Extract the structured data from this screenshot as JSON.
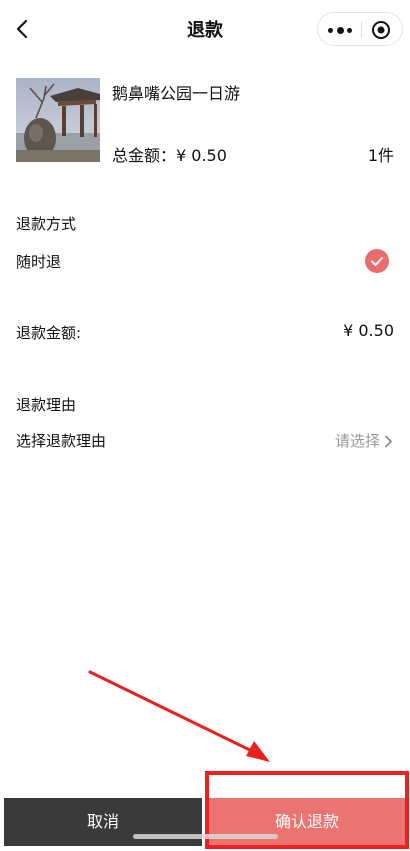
{
  "nav": {
    "title": "退款"
  },
  "product": {
    "name": "鹅鼻嘴公园一日游",
    "total_label": "总金额：",
    "total_value": "¥ 0.50",
    "quantity": "1件"
  },
  "refund_method": {
    "heading": "退款方式",
    "option": "随时退"
  },
  "refund_amount": {
    "label": "退款金额:",
    "value": "¥ 0.50"
  },
  "refund_reason": {
    "heading": "退款理由",
    "label": "选择退款理由",
    "placeholder": "请选择"
  },
  "buttons": {
    "cancel": "取消",
    "confirm": "确认退款"
  },
  "colors": {
    "accent": "#ea7570",
    "cancel_bg": "#3a3a3a",
    "annotation": "#ee1f1f"
  }
}
